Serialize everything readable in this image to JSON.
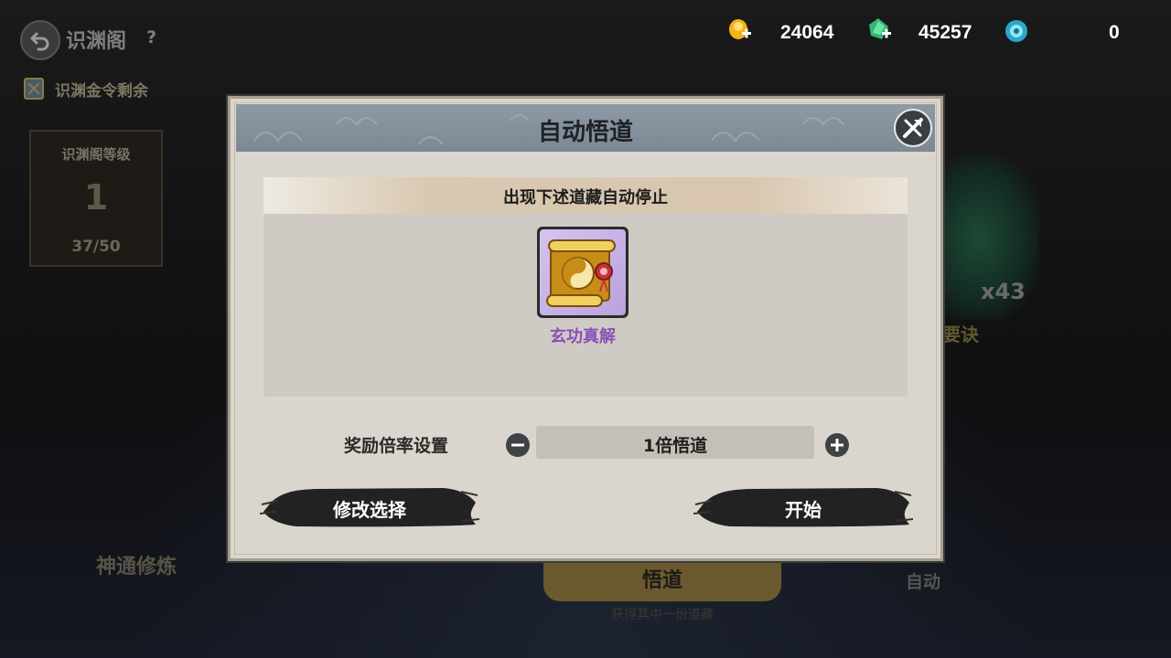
{
  "background": {
    "title": "识渊阁",
    "help": "?",
    "token_label": "识渊金令剩余",
    "level_label": "识渊阁等级",
    "level_value": "1",
    "level_progress": "37/50",
    "left_bottom_label": "神通修炼",
    "main_button_label": "悟道",
    "main_button_sub": "获得其中一份道藏",
    "right_count": "x43",
    "right_label": "要诀",
    "auto_label": "自动"
  },
  "currencies": [
    {
      "icon": "gold-ingot-plus-icon",
      "value": "24064"
    },
    {
      "icon": "jade-plus-icon",
      "value": "45257"
    },
    {
      "icon": "blue-orb-icon",
      "value": "0"
    }
  ],
  "dialog": {
    "title": "自动悟道",
    "close_icon": "close-icon",
    "banner": "出现下述道藏自动停止",
    "item": {
      "name": "玄功真解",
      "icon": "taiji-scroll-icon"
    },
    "rate_label": "奖励倍率设置",
    "rate_value": "1倍悟道",
    "modify_button": "修改选择",
    "start_button": "开始"
  },
  "colors": {
    "item_name": "#8a50b6",
    "header": "#8d99a5",
    "dialog_bg": "#dbd6cd"
  }
}
